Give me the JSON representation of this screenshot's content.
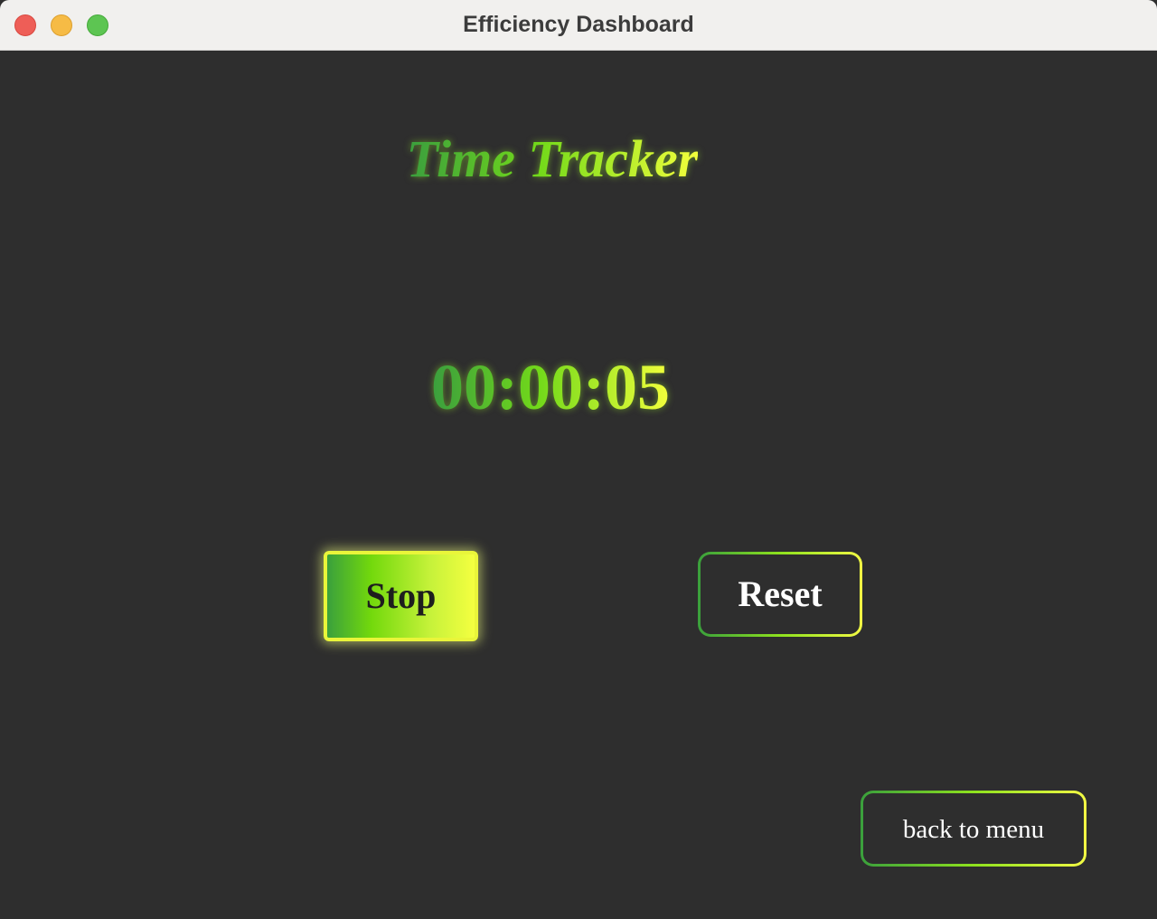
{
  "window": {
    "title": "Efficiency Dashboard",
    "controls": [
      "close",
      "minimize",
      "maximize"
    ]
  },
  "main": {
    "heading": "Time Tracker",
    "timer": "00:00:05",
    "buttons": {
      "stop": "Stop",
      "reset": "Reset",
      "back": "back to menu"
    }
  },
  "colors": {
    "background": "#2e2e2e",
    "titlebar": "#f1f0ee",
    "gradient_start": "#3a9e3e",
    "gradient_mid": "#72d91a",
    "gradient_end": "#f2ff3c",
    "button_text_light": "#ffffff",
    "button_text_dark": "#1e1e1e"
  }
}
